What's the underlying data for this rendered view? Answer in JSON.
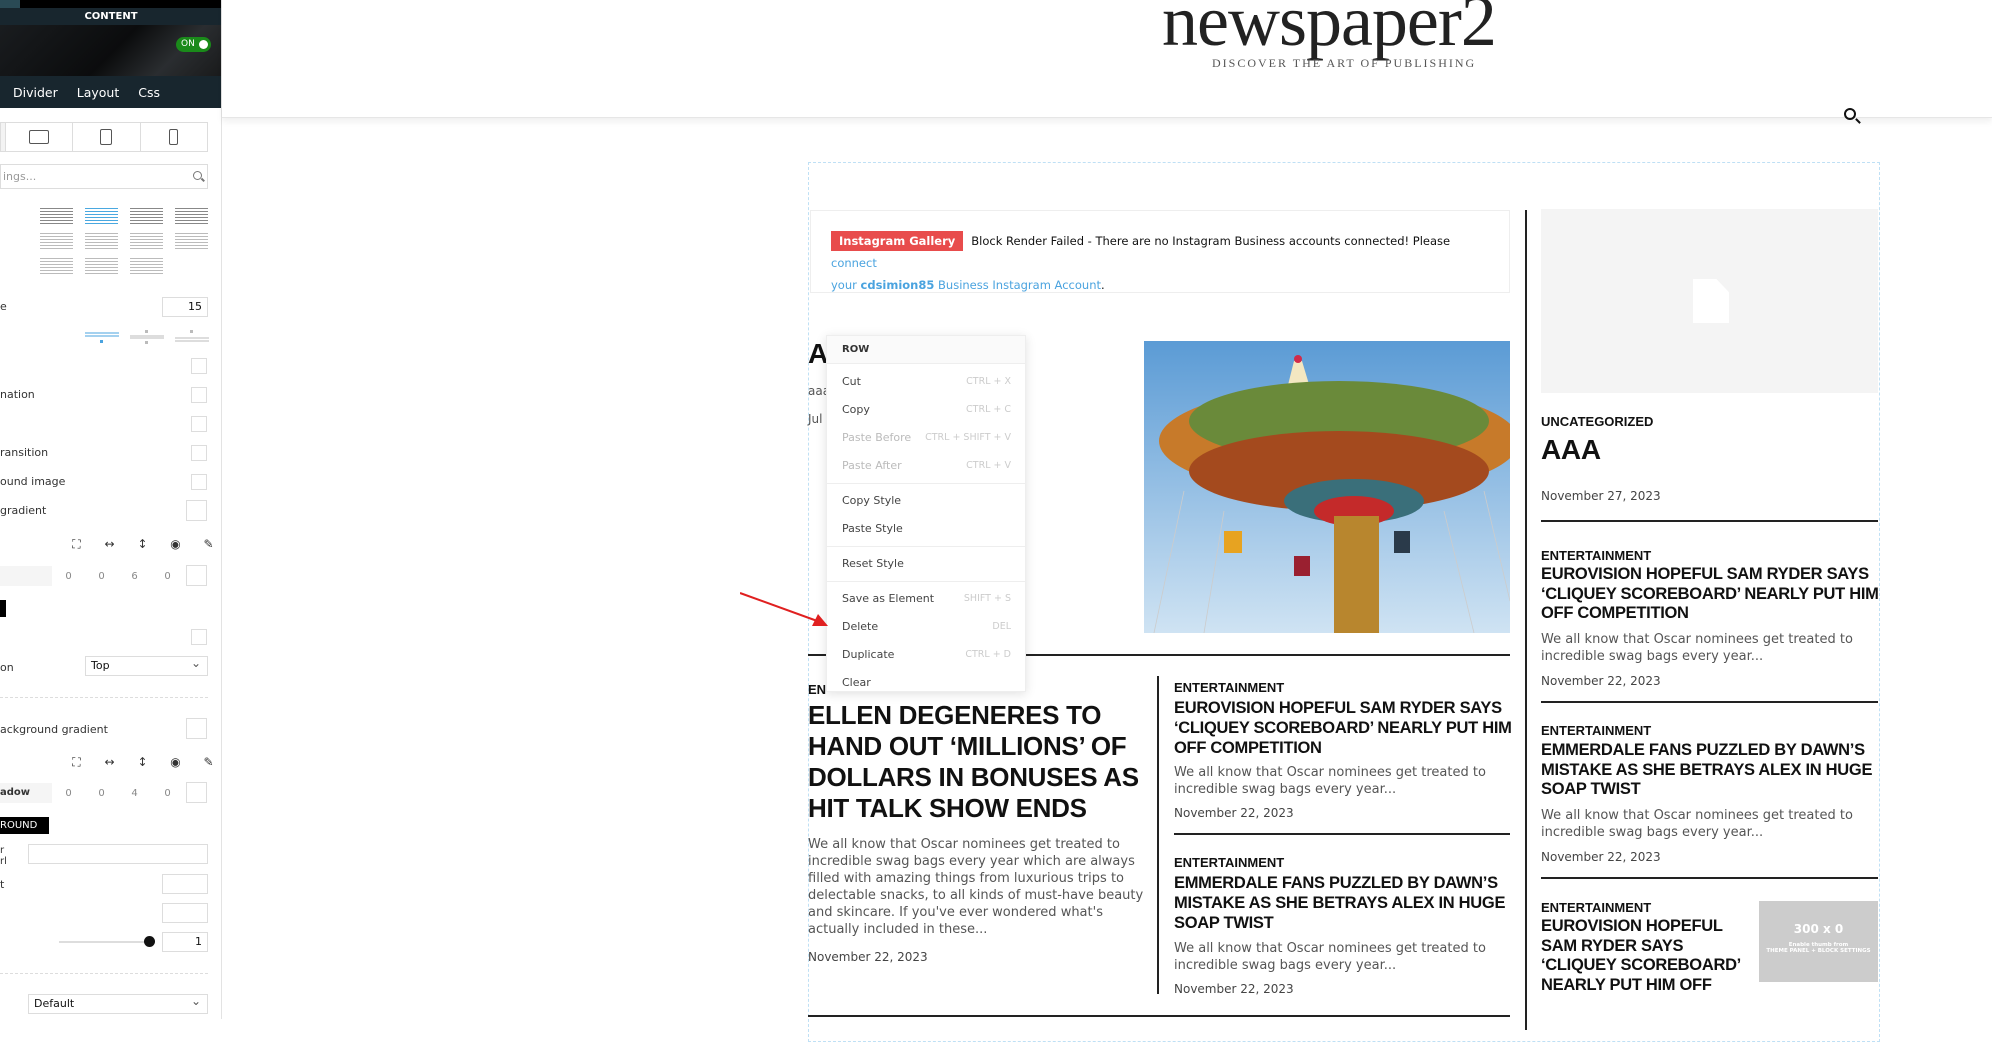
{
  "sidebar": {
    "content_label": "CONTENT",
    "toggle_label": "ON",
    "tabs": [
      "Divider",
      "Layout",
      "Css"
    ],
    "search_placeholder": "ings...",
    "rows": {
      "limit_suffix": "e",
      "limit_value": "15",
      "pagination": "nation",
      "transition": "ransition",
      "bg_image": "ound image",
      "gradient": "gradient",
      "position_label": "on",
      "position_value": "Top",
      "bg_gradient": "ackground gradient",
      "shadow_label": "adow",
      "background_badge": "ROUND",
      "url_label_1": "r",
      "url_label_2": "rl",
      "t_label": "t",
      "opacity_value": "1",
      "select_value": "Default"
    },
    "padding_values": [
      "0",
      "0",
      "6",
      "0"
    ],
    "shadow_values": [
      "0",
      "0",
      "4",
      "0"
    ]
  },
  "header": {
    "logo": "newspaper2",
    "tagline": "DISCOVER THE ART OF PUBLISHING"
  },
  "instagram": {
    "badge": "Instagram Gallery",
    "message": "Block Render Failed - There are no Instagram Business accounts connected! Please ",
    "link1": "connect",
    "link2a": "your ",
    "account": "cdsimion85",
    "link2b": " Business Instagram Account",
    "end": "."
  },
  "featured": {
    "title_partial": "A",
    "excerpt_partial": "aaa",
    "date_partial": "Jul"
  },
  "context_menu": {
    "header": "ROW",
    "items": [
      {
        "label": "Cut",
        "shortcut": "CTRL + X"
      },
      {
        "label": "Copy",
        "shortcut": "CTRL + C"
      },
      {
        "label": "Paste Before",
        "shortcut": "CTRL + SHIFT + V"
      },
      {
        "label": "Paste After",
        "shortcut": "CTRL + V"
      },
      {
        "label": "Copy Style",
        "shortcut": ""
      },
      {
        "label": "Paste Style",
        "shortcut": ""
      },
      {
        "label": "Reset Style",
        "shortcut": ""
      },
      {
        "label": "Save as Element",
        "shortcut": "SHIFT + S"
      },
      {
        "label": "Delete",
        "shortcut": "DEL"
      },
      {
        "label": "Duplicate",
        "shortcut": "CTRL + D"
      },
      {
        "label": "Clear",
        "shortcut": ""
      }
    ]
  },
  "articles": {
    "main": {
      "category": "EN",
      "title": "ELLEN DEGENERES TO HAND OUT ‘MILLIONS’ OF DOLLARS IN BONUSES AS HIT TALK SHOW ENDS",
      "excerpt": "We all know that Oscar nominees get treated to incredible swag bags every year which are always filled with amazing things from luxurious trips to delectable snacks, to all kinds of must-have beauty and skincare. If you've ever wondered what's actually included in these...",
      "date": "November 22, 2023"
    },
    "mid": [
      {
        "category": "ENTERTAINMENT",
        "title": "EUROVISION HOPEFUL SAM RYDER SAYS ‘CLIQUEY SCOREBOARD’ NEARLY PUT HIM OFF COMPETITION",
        "excerpt": "We all know that Oscar nominees get treated to incredible swag bags every year...",
        "date": "November 22, 2023"
      },
      {
        "category": "ENTERTAINMENT",
        "title": "EMMERDALE FANS PUZZLED BY DAWN’S MISTAKE AS SHE BETRAYS ALEX IN HUGE SOAP TWIST",
        "excerpt": "We all know that Oscar nominees get treated to incredible swag bags every year...",
        "date": "November 22, 2023"
      }
    ],
    "side_top": {
      "category": "UNCATEGORIZED",
      "title": "AAA",
      "date": "November 27, 2023"
    },
    "side": [
      {
        "category": "ENTERTAINMENT",
        "title": "EUROVISION HOPEFUL SAM RYDER SAYS ‘CLIQUEY SCOREBOARD’ NEARLY PUT HIM OFF COMPETITION",
        "excerpt": "We all know that Oscar nominees get treated to incredible swag bags every year...",
        "date": "November 22, 2023"
      },
      {
        "category": "ENTERTAINMENT",
        "title": "EMMERDALE FANS PUZZLED BY DAWN’S MISTAKE AS SHE BETRAYS ALEX IN HUGE SOAP TWIST",
        "excerpt": "We all know that Oscar nominees get treated to incredible swag bags every year...",
        "date": "November 22, 2023"
      },
      {
        "category": "ENTERTAINMENT",
        "title": "EUROVISION HOPEFUL SAM RYDER SAYS ‘CLIQUEY SCOREBOARD’ NEARLY PUT HIM OFF"
      }
    ],
    "thumb_placeholder": {
      "size": "300 x 0",
      "line1": "Enable thumb from",
      "line2": "THEME PANEL + BLOCK SETTINGS"
    }
  },
  "colors": {
    "accent": "#4aa3df",
    "badge_red": "#e84c4c",
    "toggle_green": "#1a8a1a",
    "sidebar_dark": "#18262e"
  }
}
